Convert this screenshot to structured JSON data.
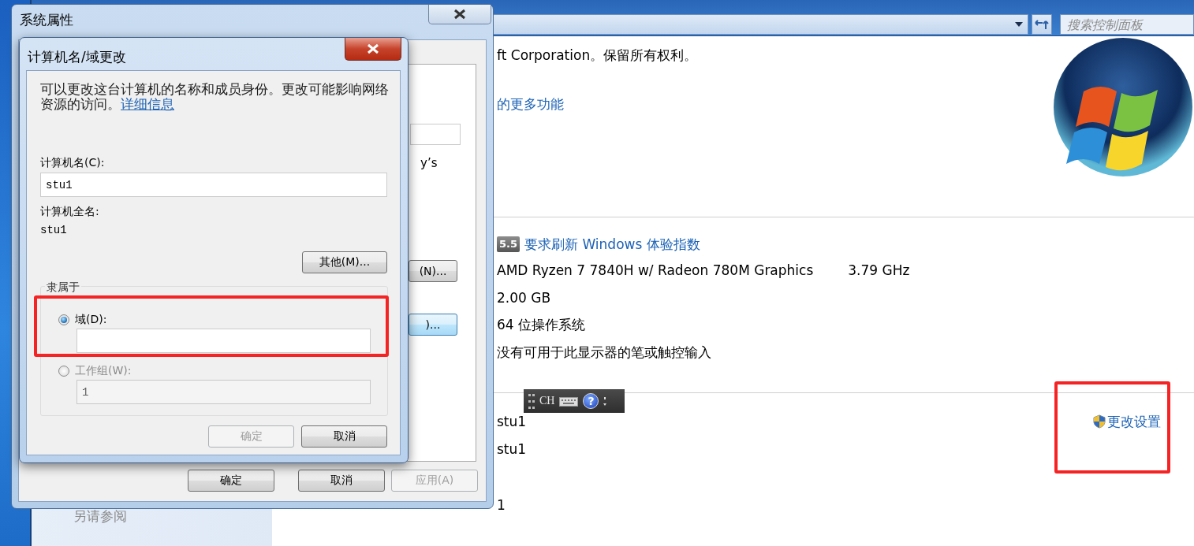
{
  "control_panel": {
    "search": {
      "placeholder": "搜索控制面板"
    },
    "copyright": "ft Corporation。保留所有权利。",
    "more_features_link": "的更多功能",
    "rating": {
      "score": "5.5",
      "link": "要求刷新 Windows 体验指数"
    },
    "system_rows": [
      {
        "value": "AMD Ryzen 7 7840H w/ Radeon 780M Graphics",
        "extra": "3.79 GHz"
      },
      {
        "value": "2.00 GB"
      },
      {
        "value": "64 位操作系统"
      },
      {
        "value": "没有可用于此显示器的笔或触控输入"
      }
    ],
    "computer_rows": [
      {
        "value": "stu1"
      },
      {
        "value": "stu1"
      }
    ],
    "change_settings": "更改设置",
    "workgroup_value": "1",
    "sidebar": {
      "heading": "另请参阅"
    }
  },
  "system_properties": {
    "title": "系统属性",
    "fragment": "y’s",
    "page_buttons": [
      {
        "label": "(N)...",
        "focused": false
      },
      {
        "label": ")...",
        "focused": true
      }
    ],
    "buttons": [
      {
        "label": "确定",
        "disabled": false
      },
      {
        "label": "取消",
        "disabled": false
      },
      {
        "label": "应用(A)",
        "disabled": true
      }
    ]
  },
  "name_dialog": {
    "title": "计算机名/域更改",
    "description": "可以更改这台计算机的名称和成员身份。更改可能影响网络资源的访问。",
    "details_link": "详细信息",
    "name_label": "计算机名(C):",
    "name_value": "stu1",
    "full_name_label": "计算机全名:",
    "full_name": "stu1",
    "more_button": "其他(M)...",
    "member_of": "隶属于",
    "options": [
      {
        "label": "域(D):",
        "selected": true,
        "disabled": false
      },
      {
        "label": "工作组(W):",
        "selected": false,
        "disabled": true,
        "value": "1"
      }
    ],
    "buttons": [
      {
        "label": "确定",
        "disabled": true
      },
      {
        "label": "取消",
        "disabled": false
      }
    ]
  },
  "ime_bar": {
    "language": "CH",
    "help": "?"
  }
}
